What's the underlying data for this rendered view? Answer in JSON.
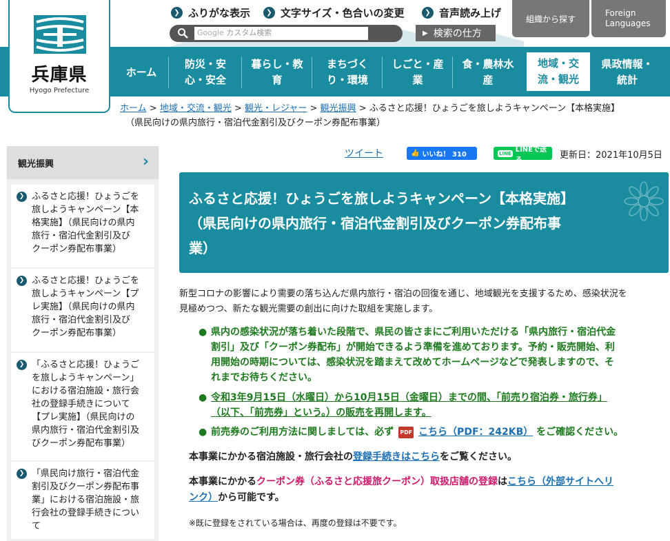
{
  "header": {
    "logo_name": "兵庫県",
    "logo_en": "Hyogo Prefecture",
    "util_links": [
      "ふりがな表示",
      "文字サイズ・色合いの変更",
      "音声読み上げ"
    ],
    "search_placeholder": "カスタム検索",
    "search_google": "Google",
    "search_button": "検索",
    "howto_button": "検索の仕方",
    "region_button": "組織から探す",
    "foreign_button_1": "Foreign",
    "foreign_button_2": "Languages"
  },
  "nav": {
    "items": [
      {
        "line1": "ホーム",
        "line2": ""
      },
      {
        "line1": "防災・安",
        "line2": "心・安全"
      },
      {
        "line1": "暮らし・教",
        "line2": "育"
      },
      {
        "line1": "まちづく",
        "line2": "り・環境"
      },
      {
        "line1": "しごと・産",
        "line2": "業"
      },
      {
        "line1": "食・農林水",
        "line2": "産"
      },
      {
        "line1": "地域・交",
        "line2": "流・観光"
      },
      {
        "line1": "県政情報・",
        "line2": "統計"
      }
    ]
  },
  "breadcrumb": {
    "links": [
      "ホーム",
      "地域・交流・観光",
      "観光・レジャー",
      "観光振興"
    ],
    "sep": ">",
    "current_1": "ふるさと応援！ひょうごを旅しようキャンペーン【本格実施】",
    "current_2": "（県民向けの県内旅行・宿泊代金割引及びクーポン券配布事業）"
  },
  "sidebar": {
    "heading": "観光振興",
    "items": [
      {
        "lines": [
          "ふるさと応援！ひょうごを",
          "旅しようキャンペーン【本",
          "格実施】（県民向けの県内",
          "旅行・宿泊代金割引及び",
          "クーポン券配布事業）"
        ]
      },
      {
        "lines": [
          "ふるさと応援！ひょうごを",
          "旅しようキャンペーン【プ",
          "レ実施】（県民向けの県内",
          "旅行・宿泊代金割引及び",
          "クーポン券配布事業）"
        ]
      },
      {
        "lines": [
          "「ふるさと応援！ひょうご",
          "を旅しようキャンペーン」",
          "における宿泊施設・旅行会",
          "社の登録手続きについて",
          "【プレ実施】（県民向けの",
          "県内旅行・宿泊代金割引及",
          "びクーポン券配布事業）"
        ]
      },
      {
        "lines": [
          "「県民向け旅行・宿泊代金",
          "割引及びクーポン券配布事",
          "業」における宿泊施設・旅",
          "行会社の登録手続きについ",
          "て"
        ]
      }
    ]
  },
  "share": {
    "tweet": "ツイート",
    "like": "いいね！ 310",
    "line": "LINEで送る",
    "line_mark": "LINE"
  },
  "update_date": "更新日：2021年10月5日",
  "title": {
    "line1": "ふるさと応援！ひょうごを旅しようキャンペーン【本格実施】",
    "line2": "（県民向けの県内旅行・宿泊代金割引及びクーポン券配布事",
    "line3": "業）"
  },
  "intro": {
    "line1": "新型コロナの影響により需要の落ち込んだ県内旅行・宿泊の回復を通じ、地域観光を支援するため、感染状況を",
    "line2": "見極めつつ、新たな観光需要の創出に向けた取組を実施します。"
  },
  "notices": {
    "item1": [
      "県内の感染状況が落ち着いた段階で、県民の皆さまにご利用いただける「県内旅行・宿泊代金",
      "割引」及び「クーポン券配布」が開始できるよう準備を進めております。予約・販売開始、利",
      "用開始の時期については、感染状況を踏まえて改めてホームページなどで発表しますので、そ",
      "れまでお待ちください。"
    ],
    "item2": [
      "令和3年9月15日（水曜日）から10月15日（金曜日）までの間、「前売り宿泊券・旅行券」",
      "（以下、「前売券」という。）の販売を再開します。"
    ],
    "item3_pre": "前売券のご利用方法に関しましては、必ず",
    "item3_pdf": "PDF",
    "item3_link": "こちら（PDF：242KB）",
    "item3_post": "をご確認ください。"
  },
  "para1": {
    "pre": "本事業にかかる宿泊施設・旅行会社の",
    "link": "登録手続きはこちら",
    "post": "をご覧ください。"
  },
  "para2": {
    "pre": "本事業にかかる",
    "magenta": "クーポン券（ふるさと応援旅クーポン）取扱店舗の登録",
    "mid": "は",
    "link_1": "こちら（外部サイトへリ",
    "link_2": "ンク）",
    "post": "から可能です。"
  },
  "note": "※既に登録をされている場合は、再度の登録は不要です。",
  "colors": {
    "teal": "#1a8ca0",
    "green": "#1e7a1e",
    "magenta": "#d0196a",
    "link": "#1a6fb5"
  }
}
